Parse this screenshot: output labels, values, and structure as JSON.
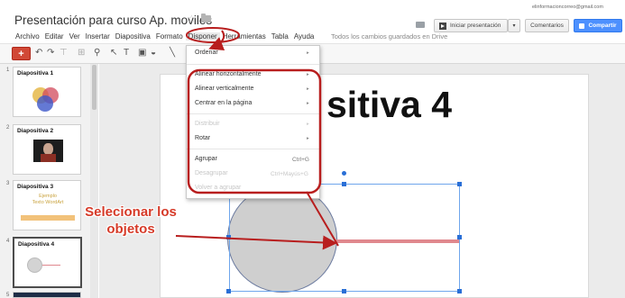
{
  "header": {
    "doc_title": "Presentación para curso Ap. moviles",
    "account_email": "elinformacioncorreo@gmail.com",
    "menus": [
      "Archivo",
      "Editar",
      "Ver",
      "Insertar",
      "Diapositiva",
      "Formato",
      "Disponer",
      "Herramientas",
      "Tabla",
      "Ayuda"
    ],
    "saved_status": "Todos los cambios guardados en Drive",
    "present_label": "Iniciar presentación",
    "comments_label": "Comentarios",
    "share_label": "Compartir"
  },
  "icons": {
    "star": "☆",
    "new": "+",
    "undo": "↶",
    "redo": "↷",
    "paint_format": "⊤",
    "zoom": "⊞",
    "search": "⚲",
    "select": "↖",
    "textbox": "T",
    "image": "▣",
    "shape": "◒",
    "line": "╲",
    "dropdown": "▾"
  },
  "slides": [
    {
      "num": "1",
      "title": "Diapositiva 1"
    },
    {
      "num": "2",
      "title": "Diapositiva 2"
    },
    {
      "num": "3",
      "title": "Diapositiva 3"
    },
    {
      "num": "4",
      "title": "Diapositiva 4"
    },
    {
      "num": "5",
      "title": ""
    }
  ],
  "thumb3_text": [
    "Ejemplo",
    "Texto WordArt"
  ],
  "canvas": {
    "slide_title": "sitiva 4"
  },
  "dropdown_menu": {
    "ordenar": "Ordenar",
    "alinear_h": "Alinear horizontalmente",
    "alinear_v": "Alinear verticalmente",
    "centrar": "Centrar en la página",
    "distribuir": "Distribuir",
    "rotar": "Rotar",
    "agrupar": "Agrupar",
    "agrupar_shortcut": "Ctrl+G",
    "desagrupar": "Desagrupar",
    "desagrupar_shortcut": "Ctrl+Mayús+G",
    "volver_agrupar": "Volver a agrupar"
  },
  "annotation": {
    "text": "Selecionar los objetos"
  },
  "colors": {
    "accent_red": "#d63a28",
    "share_blue": "#4d90fe",
    "new_red": "#d14836"
  }
}
